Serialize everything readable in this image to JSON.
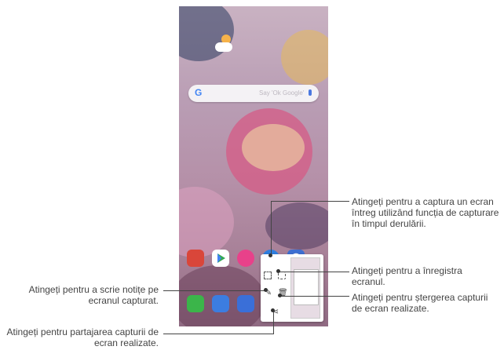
{
  "phone": {
    "search_placeholder": "Say 'Ok Google'"
  },
  "callouts": {
    "capture_scroll": "Atingeți pentru a captura un ecran întreg utilizând funcția de capturare în timpul derulării.",
    "record_screen": "Atingeți pentru a înregistra ecranul.",
    "delete_capture": "Atingeți pentru ștergerea capturii de ecran realizate.",
    "write_notes": "Atingeți pentru a scrie notițe pe ecranul capturat.",
    "share_capture": "Atingeți pentru partajarea capturii de ecran realizate."
  },
  "icons": {
    "capture_scroll": "scroll-capture-icon",
    "record": "record-icon",
    "edit": "pen-icon",
    "delete": "trash-icon",
    "share": "share-icon"
  },
  "colors": {
    "accent": "#4285f4"
  }
}
